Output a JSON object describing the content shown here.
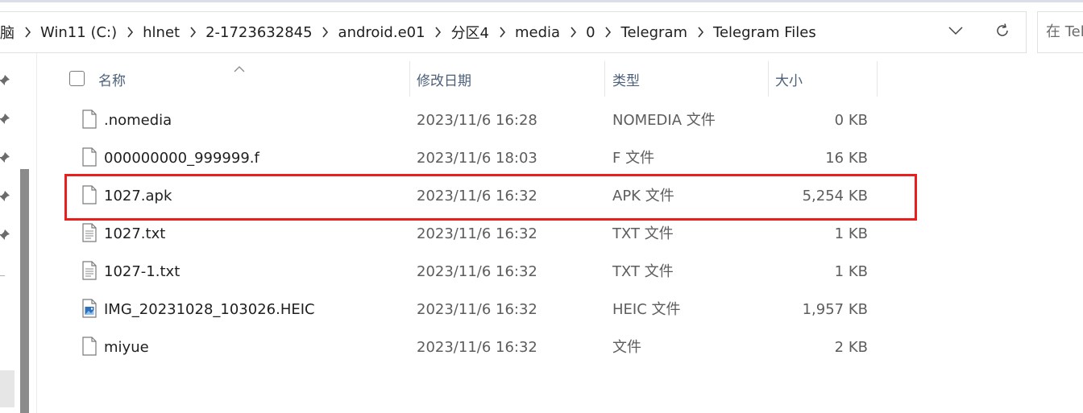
{
  "breadcrumb": [
    {
      "label": "脑"
    },
    {
      "label": "Win11 (C:)"
    },
    {
      "label": "hlnet"
    },
    {
      "label": "2-1723632845"
    },
    {
      "label": "android.e01"
    },
    {
      "label": "分区4"
    },
    {
      "label": "media"
    },
    {
      "label": "0"
    },
    {
      "label": "Telegram"
    },
    {
      "label": "Telegram Files"
    }
  ],
  "address_actions": {
    "dropdown_icon": "chevron-down-icon",
    "refresh_icon": "refresh-icon"
  },
  "search": {
    "placeholder": "在 Tel"
  },
  "columns": {
    "name": "名称",
    "date": "修改日期",
    "type": "类型",
    "size": "大小"
  },
  "files": [
    {
      "name": ".nomedia",
      "date": "2023/11/6 16:28",
      "type": "NOMEDIA 文件",
      "size": "0 KB",
      "icon": "blank-file-icon"
    },
    {
      "name": "000000000_999999.f",
      "date": "2023/11/6 18:03",
      "type": "F 文件",
      "size": "16 KB",
      "icon": "blank-file-icon"
    },
    {
      "name": "1027.apk",
      "date": "2023/11/6 16:32",
      "type": "APK 文件",
      "size": "5,254 KB",
      "icon": "blank-file-icon",
      "highlighted": true
    },
    {
      "name": "1027.txt",
      "date": "2023/11/6 16:32",
      "type": "TXT 文件",
      "size": "1 KB",
      "icon": "text-file-icon"
    },
    {
      "name": "1027-1.txt",
      "date": "2023/11/6 16:32",
      "type": "TXT 文件",
      "size": "1 KB",
      "icon": "text-file-icon"
    },
    {
      "name": "IMG_20231028_103026.HEIC",
      "date": "2023/11/6 16:32",
      "type": "HEIC 文件",
      "size": "1,957 KB",
      "icon": "image-file-icon"
    },
    {
      "name": "miyue",
      "date": "2023/11/6 16:32",
      "type": "文件",
      "size": "2 KB",
      "icon": "blank-file-icon"
    }
  ],
  "colors": {
    "highlight": "#e8201d",
    "header_text": "#4c607a"
  }
}
